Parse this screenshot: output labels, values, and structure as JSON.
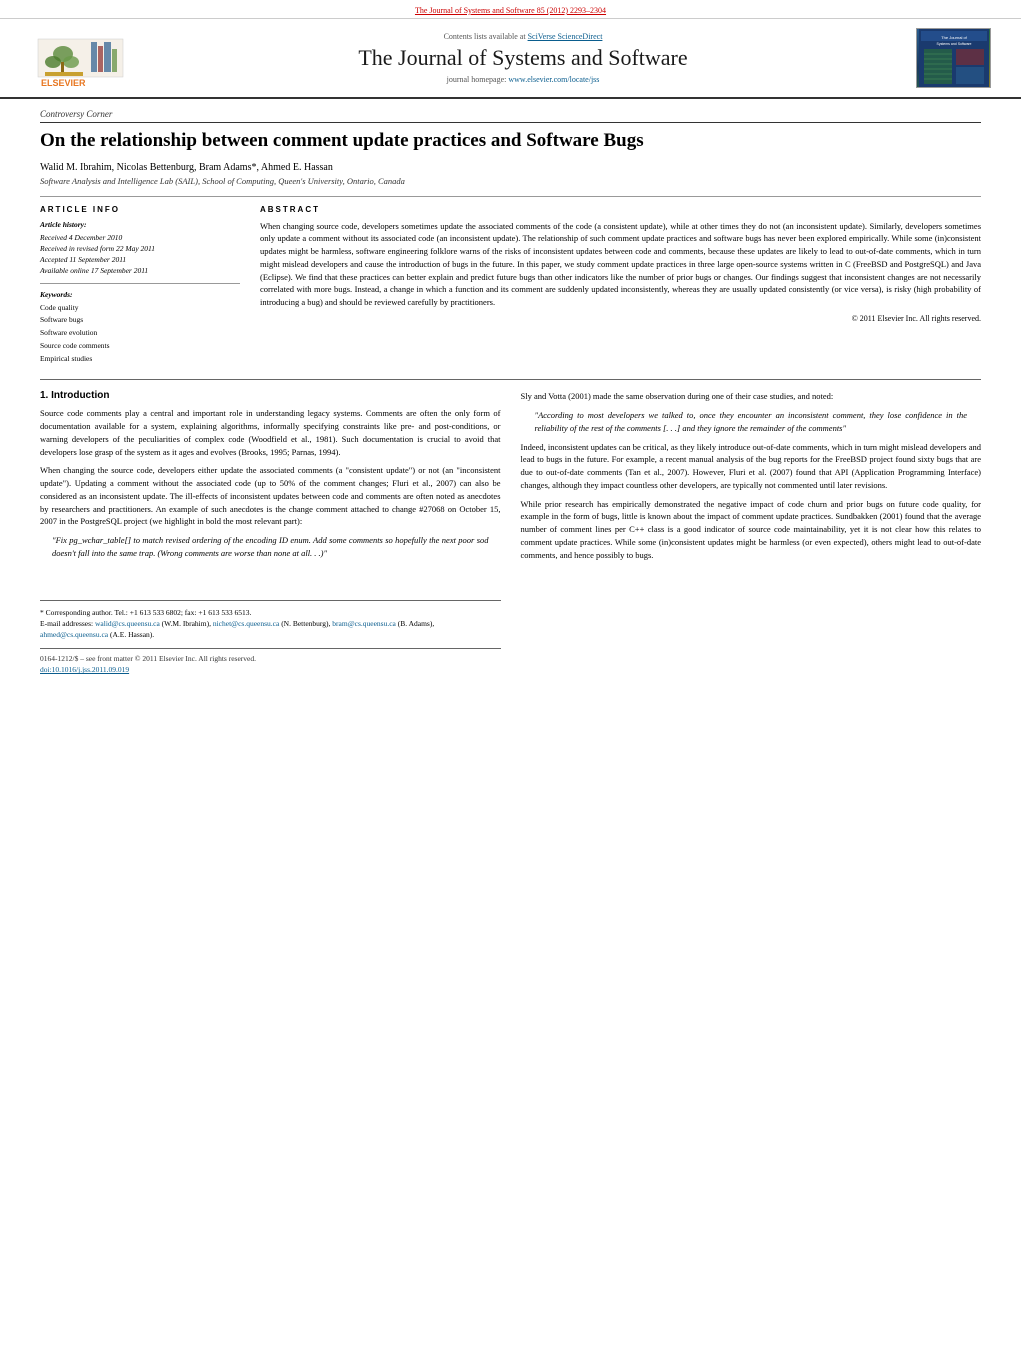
{
  "top_banner": {
    "link_text": "The Journal of Systems and Software 85 (2012) 2293–2304"
  },
  "journal_header": {
    "contents_line": "Contents lists available at",
    "sciverse_text": "SciVerse ScienceDirect",
    "title": "The Journal of Systems and Software",
    "homepage_label": "journal homepage:",
    "homepage_url": "www.elsevier.com/locate/jss"
  },
  "article": {
    "section": "Controversy Corner",
    "title": "On the relationship between comment update practices and Software Bugs",
    "authors": "Walid M. Ibrahim, Nicolas Bettenburg, Bram Adams*, Ahmed E. Hassan",
    "affiliation": "Software Analysis and Intelligence Lab (SAIL), School of Computing, Queen's University, Ontario, Canada",
    "article_info_label": "ARTICLE INFO",
    "abstract_label": "ABSTRACT",
    "history": {
      "label": "Article history:",
      "received": "Received 4 December 2010",
      "revised": "Received in revised form 22 May 2011",
      "accepted": "Accepted 11 September 2011",
      "available": "Available online 17 September 2011"
    },
    "keywords": {
      "label": "Keywords:",
      "items": [
        "Code quality",
        "Software bugs",
        "Software evolution",
        "Source code comments",
        "Empirical studies"
      ]
    },
    "abstract": "When changing source code, developers sometimes update the associated comments of the code (a consistent update), while at other times they do not (an inconsistent update). Similarly, developers sometimes only update a comment without its associated code (an inconsistent update). The relationship of such comment update practices and software bugs has never been explored empirically. While some (in)consistent updates might be harmless, software engineering folklore warns of the risks of inconsistent updates between code and comments, because these updates are likely to lead to out-of-date comments, which in turn might mislead developers and cause the introduction of bugs in the future. In this paper, we study comment update practices in three large open-source systems written in C (FreeBSD and PostgreSQL) and Java (Eclipse). We find that these practices can better explain and predict future bugs than other indicators like the number of prior bugs or changes. Our findings suggest that inconsistent changes are not necessarily correlated with more bugs. Instead, a change in which a function and its comment are suddenly updated inconsistently, whereas they are usually updated consistently (or vice versa), is risky (high probability of introducing a bug) and should be reviewed carefully by practitioners.",
    "copyright": "© 2011 Elsevier Inc. All rights reserved.",
    "intro": {
      "heading": "1. Introduction",
      "p1": "Source code comments play a central and important role in understanding legacy systems. Comments are often the only form of documentation available for a system, explaining algorithms, informally specifying constraints like pre- and post-conditions, or warning developers of the peculiarities of complex code (Woodfield et al., 1981). Such documentation is crucial to avoid that developers lose grasp of the system as it ages and evolves (Brooks, 1995; Parnas, 1994).",
      "p2": "When changing the source code, developers either update the associated comments (a \"consistent update\") or not (an \"inconsistent update\"). Updating a comment without the associated code (up to 50% of the comment changes; Fluri et al., 2007) can also be considered as an inconsistent update. The ill-effects of inconsistent updates between code and comments are often noted as anecdotes by researchers and practitioners. An example of such anecdotes is the change comment attached to change #27068 on October 15, 2007 in the PostgreSQL project (we highlight in bold the most relevant part):",
      "quote1": "\"Fix pg_wchar_table[] to match revised ordering of the encoding ID enum. Add some comments so hopefully the next poor sod doesn't fall into the same trap. (Wrong comments are worse than none at all. . .)\""
    },
    "right_col": {
      "p1": "Sly and Votta (2001) made the same observation during one of their case studies, and noted:",
      "quote2": "\"According to most developers we talked to, once they encounter an inconsistent comment, they lose confidence in the reliability of the rest of the comments [. . .] and they ignore the remainder of the comments\"",
      "p2": "Indeed, inconsistent updates can be critical, as they likely introduce out-of-date comments, which in turn might mislead developers and lead to bugs in the future. For example, a recent manual analysis of the bug reports for the FreeBSD project found sixty bugs that are due to out-of-date comments (Tan et al., 2007). However, Fluri et al. (2007) found that API (Application Programming Interface) changes, although they impact countless other developers, are typically not commented until later revisions.",
      "p3": "While prior research has empirically demonstrated the negative impact of code churn and prior bugs on future code quality, for example in the form of bugs, little is known about the impact of comment update practices. Sundbakken (2001) found that the average number of comment lines per C++ class is a good indicator of source code maintainability, yet it is not clear how this relates to comment update practices. While some (in)consistent updates might be harmless (or even expected), others might lead to out-of-date comments, and hence possibly to bugs."
    }
  },
  "footnotes": {
    "corresponding": "* Corresponding author. Tel.: +1 613 533 6802; fax: +1 613 533 6513.",
    "emails_label": "E-mail addresses:",
    "emails": "walid@cs.queensu.ca (W.M. Ibrahim), nichet@cs.queensu.ca (N. Bettenburg), bram@cs.queensu.ca (B. Adams), ahmed@cs.queensu.ca (A.E. Hassan).",
    "issn": "0164-1212/$ – see front matter © 2011 Elsevier Inc. All rights reserved.",
    "doi": "doi:10.1016/j.jss.2011.09.019"
  }
}
